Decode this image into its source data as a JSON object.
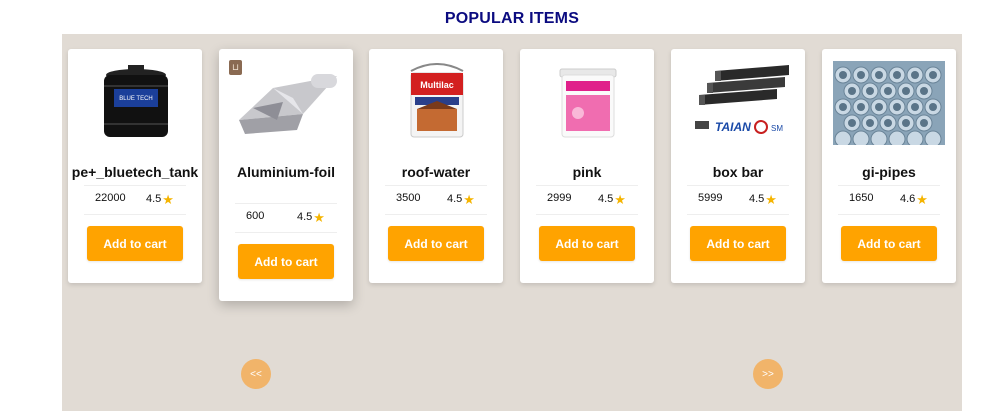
{
  "section": {
    "title": "POPULAR ITEMS"
  },
  "products": [
    {
      "name": "pe+_bluetech_tank",
      "price": "22000",
      "rating": "4.5",
      "button": "Add to cart"
    },
    {
      "name": "Aluminium-foil",
      "price": "600",
      "rating": "4.5",
      "button": "Add to cart"
    },
    {
      "name": "roof-water",
      "price": "3500",
      "rating": "4.5",
      "button": "Add to cart"
    },
    {
      "name": "pink",
      "price": "2999",
      "rating": "4.5",
      "button": "Add to cart"
    },
    {
      "name": "box bar",
      "price": "5999",
      "rating": "4.5",
      "button": "Add to cart"
    },
    {
      "name": "gi-pipes",
      "price": "1650",
      "rating": "4.6",
      "button": "Add to cart"
    }
  ],
  "nav": {
    "prev": "<<",
    "next": ">>"
  },
  "icons": {
    "rating": "star-icon",
    "badge": "bookmark-icon"
  },
  "colors": {
    "title": "#0b0b80",
    "button": "#ffa300",
    "nav": "#f1b46a",
    "star": "#f5b400",
    "background": "#e1dbd4"
  }
}
